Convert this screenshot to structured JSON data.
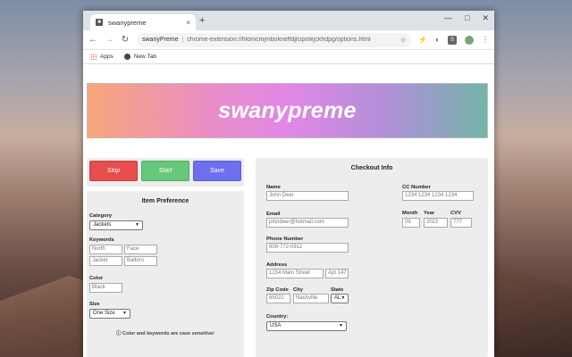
{
  "browser": {
    "tab_title": "swanypreme",
    "tab_favicon": "■",
    "tab_close": "×",
    "new_tab": "+",
    "window_controls": [
      "—",
      "□",
      "✕"
    ],
    "nav": {
      "back": "←",
      "forward": "→",
      "reload": "↻"
    },
    "omnibox": {
      "ext_name": "swanyPreme",
      "separator": "|",
      "url": "chrome-extension://hlomcmjmbokneffdjlcipmkjckhdpg/options.html",
      "star": "☆"
    },
    "toolbar_icons": [
      "⚡",
      "◐"
    ],
    "toolbar_s": "S",
    "menu": "⋮",
    "bookmarks": [
      {
        "label": "Apps"
      },
      {
        "label": "New Tab"
      }
    ]
  },
  "banner": {
    "title": "swanypreme"
  },
  "actions": {
    "stop": "Stop",
    "start": "Start",
    "save": "Save"
  },
  "item_preference": {
    "title": "Item Preference",
    "category_label": "Category",
    "category_value": "Jackets",
    "keywords_label": "Keywords",
    "keywords": [
      "North",
      "Face",
      "Jacket",
      "Baltoro"
    ],
    "color_label": "Color",
    "color_value": "Black",
    "size_label": "Size",
    "size_value": "One Size",
    "note": "ⓘ Color and keywords are case sensitive!"
  },
  "checkout": {
    "title": "Checkout Info",
    "name_label": "Name",
    "name_placeholder": "John Deer",
    "email_label": "Email",
    "email_placeholder": "johndeer@hotmail.com",
    "phone_label": "Phone Number",
    "phone_placeholder": "608-772-0912",
    "address_label": "Address",
    "address_placeholder": "1234 Main Street",
    "apt_placeholder": "Apt 147",
    "zip_label": "Zip Code",
    "zip_placeholder": "65022",
    "city_label": "City",
    "city_placeholder": "Nashville",
    "state_label": "State",
    "state_value": "AL",
    "country_label": "Country:",
    "country_value": "USA",
    "cc_label": "CC Number",
    "cc_placeholder": "1234 1234 1234 1234",
    "month_label": "Month",
    "month_placeholder": "09",
    "year_label": "Year",
    "year_placeholder": "2022",
    "cvv_label": "CVV",
    "cvv_placeholder": "777"
  },
  "colors": {
    "stop": "#e64d4d",
    "start": "#67c77a",
    "save": "#6e6ef0"
  }
}
